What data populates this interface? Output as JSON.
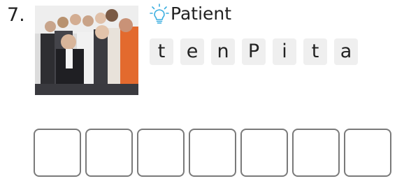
{
  "question": {
    "number": "7."
  },
  "image": {
    "subject": "crowd-of-business-people"
  },
  "hint": {
    "icon": "lightbulb-icon",
    "word": "Patient",
    "color": "#3aaee0"
  },
  "scrambled_letters": [
    "t",
    "e",
    "n",
    "P",
    "i",
    "t",
    "a"
  ],
  "answer_slots": 7
}
